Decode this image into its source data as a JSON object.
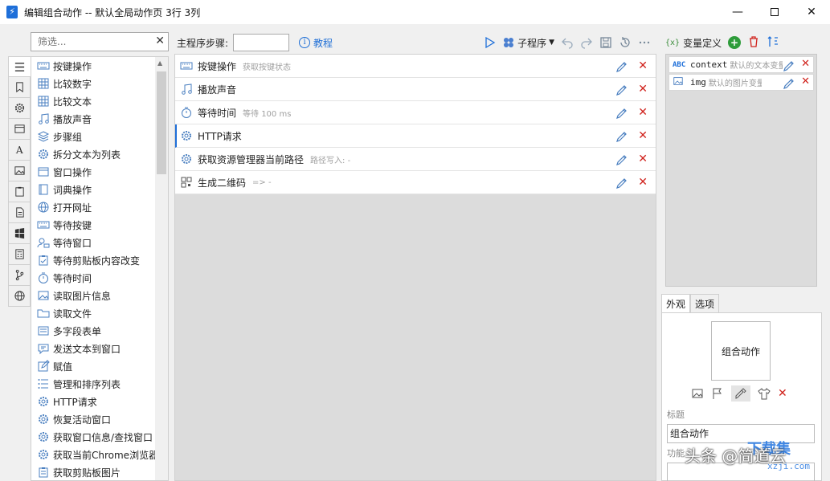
{
  "window": {
    "title": "编辑组合动作 -- 默认全局动作页 3行 3列",
    "app_icon": "lightning-icon",
    "controls": [
      "minimize-icon",
      "maximize-icon",
      "close-icon"
    ]
  },
  "filter": {
    "placeholder": "筛选...",
    "clear": "✕"
  },
  "tabstrip": [
    "list-icon",
    "bookmark-icon",
    "gear-icon",
    "window-icon",
    "font-icon",
    "image-icon",
    "clipboard-icon",
    "document-icon",
    "windows-icon",
    "calculator-icon",
    "branch-icon",
    "globe-icon"
  ],
  "actions": [
    {
      "label": "按键操作",
      "icon": "keyboard-icon"
    },
    {
      "label": "比较数字",
      "icon": "table-icon"
    },
    {
      "label": "比较文本",
      "icon": "table-icon"
    },
    {
      "label": "播放声音",
      "icon": "music-icon"
    },
    {
      "label": "步骤组",
      "icon": "layers-icon"
    },
    {
      "label": "拆分文本为列表",
      "icon": "gear-icon"
    },
    {
      "label": "窗口操作",
      "icon": "window-icon"
    },
    {
      "label": "词典操作",
      "icon": "dictionary-icon"
    },
    {
      "label": "打开网址",
      "icon": "globe-icon"
    },
    {
      "label": "等待按键",
      "icon": "keyboard-icon"
    },
    {
      "label": "等待窗口",
      "icon": "user-window-icon"
    },
    {
      "label": "等待剪贴板内容改变",
      "icon": "clipboard-check-icon"
    },
    {
      "label": "等待时间",
      "icon": "timer-icon"
    },
    {
      "label": "读取图片信息",
      "icon": "image-icon"
    },
    {
      "label": "读取文件",
      "icon": "folder-icon"
    },
    {
      "label": "多字段表单",
      "icon": "form-icon"
    },
    {
      "label": "发送文本到窗口",
      "icon": "message-icon"
    },
    {
      "label": "赋值",
      "icon": "edit-icon"
    },
    {
      "label": "管理和排序列表",
      "icon": "list-icon"
    },
    {
      "label": "HTTP请求",
      "icon": "gear-icon"
    },
    {
      "label": "恢复活动窗口",
      "icon": "gear-icon"
    },
    {
      "label": "获取窗口信息/查找窗口",
      "icon": "gear-icon"
    },
    {
      "label": "获取当前Chrome浏览器",
      "icon": "gear-icon"
    },
    {
      "label": "获取剪贴板图片",
      "icon": "clipboard-icon"
    }
  ],
  "main_toolbar": {
    "label": "主程序步骤:",
    "tutorial": "教程",
    "subprogram": "子程序",
    "icons": [
      "play-icon",
      "subprogram-icon",
      "chevron-down-icon",
      "undo-icon",
      "redo-icon",
      "save-icon",
      "history-icon",
      "more-icon"
    ]
  },
  "steps": [
    {
      "name": "按键操作",
      "desc": "获取按键状态",
      "icon": "keyboard-icon",
      "selected": false
    },
    {
      "name": "播放声音",
      "desc": "",
      "icon": "music-icon",
      "selected": false
    },
    {
      "name": "等待时间",
      "desc": "等待 100 ms",
      "icon": "timer-icon",
      "selected": false
    },
    {
      "name": "HTTP请求",
      "desc": "",
      "icon": "gear-icon",
      "selected": true
    },
    {
      "name": "获取资源管理器当前路径",
      "desc": "路径写入: -",
      "icon": "gear-icon",
      "selected": false
    },
    {
      "name": "生成二维码",
      "desc": "=> -",
      "icon": "qrcode-icon",
      "selected": false
    }
  ],
  "variables": {
    "title": "变量定义",
    "curly": "{x}",
    "items": [
      {
        "type": "ABC",
        "name": "context",
        "value": "默认的文本变量"
      },
      {
        "type": "IMG",
        "name": "img",
        "value": "默认的图片变量"
      }
    ]
  },
  "right_panel": {
    "tabs": [
      "外观",
      "选项"
    ],
    "preview_text": "组合动作",
    "title_label": "标题",
    "title_value": "组合动作",
    "func_label": "功能"
  },
  "watermark": {
    "text": "头条 @简道云",
    "brand": "下载集",
    "site": "xzji.com"
  },
  "colors": {
    "accent": "#1e6fd9",
    "delete": "#d0231d",
    "add": "#2e9c3a"
  }
}
